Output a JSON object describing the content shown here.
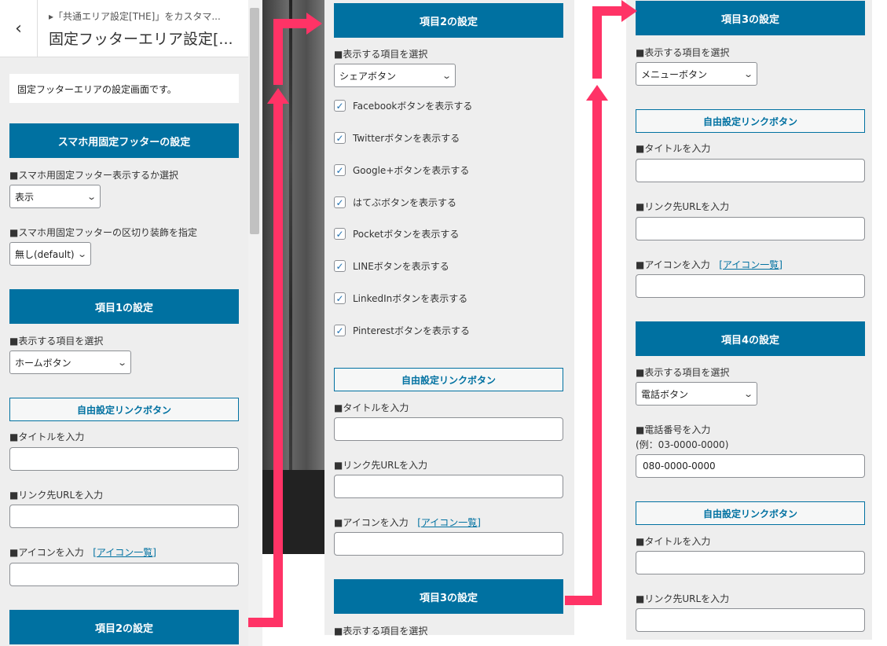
{
  "left": {
    "breadcrumb": "▸「共通エリア設定[THE]」をカスタマ...",
    "title": "固定フッターエリア設定[...",
    "description": "固定フッターエリアの設定画面です。",
    "sp_footer_header": "スマホ用固定フッターの設定",
    "display_label": "■スマホ用固定フッター表示するか選択",
    "display_value": "表示",
    "divider_label": "■スマホ用固定フッターの区切り装飾を指定",
    "divider_value": "無し(default)",
    "item1_header": "項目1の設定",
    "item1_select_label": "■表示する項目を選択",
    "item1_select_value": "ホームボタン",
    "free_link_label": "自由設定リンクボタン",
    "title_label": "■タイトルを入力",
    "url_label": "■リンク先URLを入力",
    "icon_label": "■アイコンを入力",
    "icon_link": "[アイコン一覧]",
    "item2_header": "項目2の設定"
  },
  "middle": {
    "item2_header": "項目2の設定",
    "select_label": "■表示する項目を選択",
    "select_value": "シェアボタン",
    "checkboxes": [
      "Facebookボタンを表示する",
      "Twitterボタンを表示する",
      "Google+ボタンを表示する",
      "はてぶボタンを表示する",
      "Pocketボタンを表示する",
      "LINEボタンを表示する",
      "LinkedInボタンを表示する",
      "Pinterestボタンを表示する"
    ],
    "free_link_label": "自由設定リンクボタン",
    "title_label": "■タイトルを入力",
    "url_label": "■リンク先URLを入力",
    "icon_label": "■アイコンを入力",
    "icon_link": "[アイコン一覧]",
    "item3_header": "項目3の設定",
    "item3_select_label": "■表示する項目を選択"
  },
  "right": {
    "item3_header": "項目3の設定",
    "item3_select_label": "■表示する項目を選択",
    "item3_select_value": "メニューボタン",
    "free_link_label": "自由設定リンクボタン",
    "title_label": "■タイトルを入力",
    "url_label": "■リンク先URLを入力",
    "icon_label": "■アイコンを入力",
    "icon_link": "[アイコン一覧]",
    "item4_header": "項目4の設定",
    "item4_select_label": "■表示する項目を選択",
    "item4_select_value": "電話ボタン",
    "phone_label": "■電話番号を入力",
    "phone_example": "(例：03-0000-0000)",
    "phone_value": "080-0000-0000",
    "free_link_label2": "自由設定リンクボタン",
    "title_label2": "■タイトルを入力",
    "url_label2": "■リンク先URLを入力"
  },
  "colors": {
    "header_bg": "#0071a1",
    "arrow": "#ff3366",
    "panel_bg": "#eeeeee"
  },
  "icons": {
    "back": "chevron-left-icon",
    "select": "chevron-down-icon",
    "check": "checkmark-icon"
  }
}
